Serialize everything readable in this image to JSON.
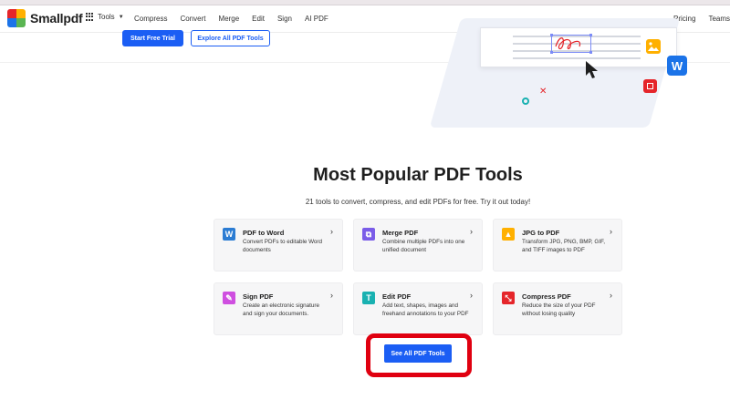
{
  "brand": {
    "name": "Smallpdf"
  },
  "nav": {
    "tools_label": "Tools",
    "links": [
      "Compress",
      "Convert",
      "Merge",
      "Edit",
      "Sign",
      "AI PDF"
    ],
    "right_links": [
      "Pricing",
      "Teams"
    ]
  },
  "hero": {
    "primary_button": "Start Free Trial",
    "secondary_button": "Explore All PDF Tools"
  },
  "section": {
    "title": "Most Popular PDF Tools",
    "subtitle": "21 tools to convert, compress, and edit PDFs for free. Try it out today!"
  },
  "tools": [
    {
      "title": "PDF to Word",
      "desc": "Convert PDFs to editable Word documents",
      "icon": "word-icon",
      "glyph": "W",
      "color": "#2b7cd3"
    },
    {
      "title": "Merge PDF",
      "desc": "Combine multiple PDFs into one unified document",
      "icon": "merge-icon",
      "glyph": "⧉",
      "color": "#7a5ce8"
    },
    {
      "title": "JPG to PDF",
      "desc": "Transform JPG, PNG, BMP, GIF, and TIFF images to PDF",
      "icon": "image-icon",
      "glyph": "▲",
      "color": "#ffb000"
    },
    {
      "title": "Sign PDF",
      "desc": "Create an electronic signature and sign your documents.",
      "icon": "signature-icon",
      "glyph": "✎",
      "color": "#cf4fe0"
    },
    {
      "title": "Edit PDF",
      "desc": "Add text, shapes, images and freehand annotations to your PDF",
      "icon": "edit-text-icon",
      "glyph": "T",
      "color": "#19b1b1"
    },
    {
      "title": "Compress PDF",
      "desc": "Reduce the size of your PDF without losing quality",
      "icon": "compress-icon",
      "glyph": "⤡",
      "color": "#e5252a"
    }
  ],
  "cta": {
    "see_all": "See All PDF Tools"
  },
  "illustration": {
    "badge_letter": "W"
  }
}
